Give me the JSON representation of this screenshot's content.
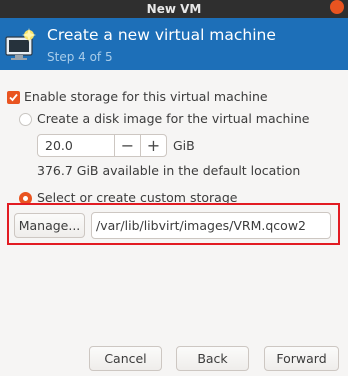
{
  "window": {
    "title": "New VM"
  },
  "banner": {
    "title": "Create a new virtual machine",
    "step": "Step 4 of 5"
  },
  "storage": {
    "enable_label": "Enable storage for this virtual machine",
    "enable_checked": true,
    "disk_image": {
      "label": "Create a disk image for the virtual machine",
      "selected": false,
      "size_value": "20.0",
      "minus": "−",
      "plus": "+",
      "unit": "GiB",
      "available": "376.7 GiB available in the default location"
    },
    "custom": {
      "label": "Select or create custom storage",
      "selected": true,
      "manage_label": "Manage...",
      "path_value": "/var/lib/libvirt/images/VRM.qcow2"
    }
  },
  "footer": {
    "cancel": "Cancel",
    "back": "Back",
    "forward": "Forward"
  },
  "colors": {
    "banner": "#1d6fb8",
    "accent": "#e95420",
    "highlight": "#e21b22"
  }
}
